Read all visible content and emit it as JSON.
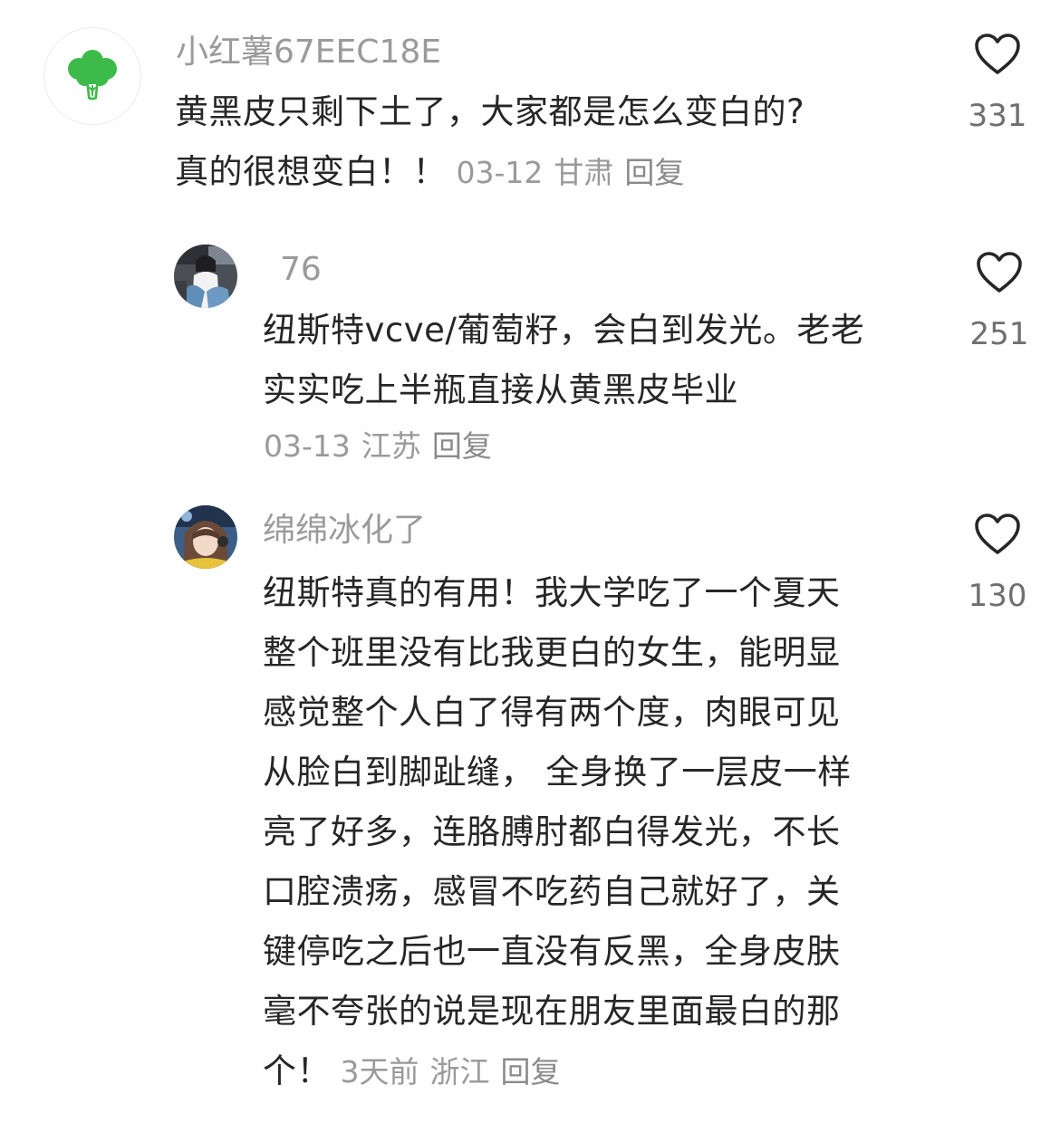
{
  "comments": [
    {
      "username": "小红薯67EEC18E",
      "lines": [
        "黄黑皮只剩下土了，大家都是怎么变白的?",
        "真的很想变白！！"
      ],
      "date": "03-12",
      "location": "甘肃",
      "reply_label": "回复",
      "likes": "331",
      "avatar_icon": "broccoli-icon"
    },
    {
      "username": "76",
      "lines": [
        "纽斯特vcve/葡萄籽，会白到发光。老老",
        "实实吃上半瓶直接从黄黑皮毕业"
      ],
      "date": "03-13",
      "location": "江苏",
      "reply_label": "回复",
      "likes": "251"
    },
    {
      "username": "绵绵冰化了",
      "lines": [
        "纽斯特真的有用！我大学吃了一个夏天",
        "整个班里没有比我更白的女生，能明显",
        "感觉整个人白了得有两个度，肉眼可见",
        "从脸白到脚趾缝， 全身换了一层皮一样",
        "亮了好多，连胳膊肘都白得发光，不长",
        "口腔溃疡，感冒不吃药自己就好了，关",
        "键停吃之后也一直没有反黑，全身皮肤",
        "毫不夸张的说是现在朋友里面最白的那",
        "个！"
      ],
      "date": "3天前",
      "location": "浙江",
      "reply_label": "回复",
      "likes": "130"
    }
  ],
  "colors": {
    "text": "#262626",
    "secondary": "#9a9a9a",
    "broccoli": "#3dbb4a"
  }
}
